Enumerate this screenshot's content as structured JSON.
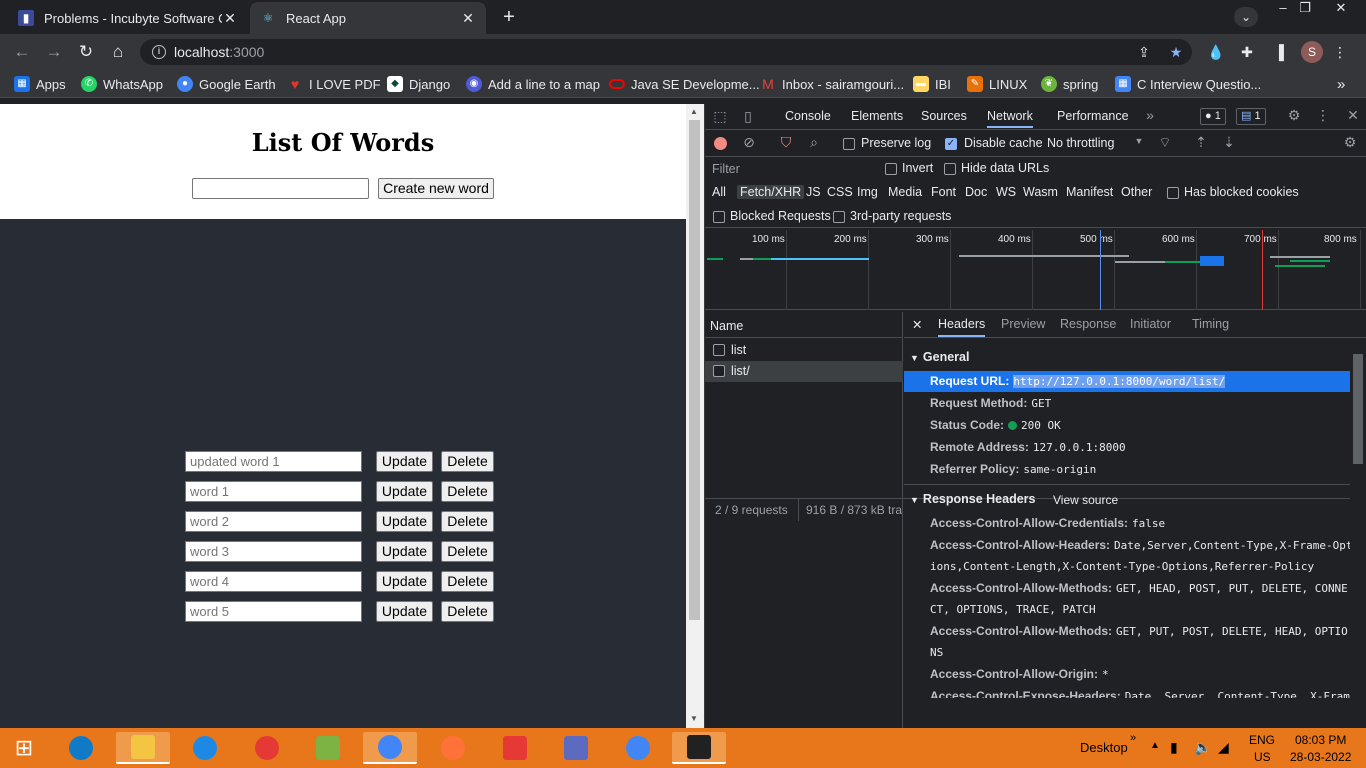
{
  "browser": {
    "tabs": [
      {
        "title": "Problems - Incubyte Software Cra",
        "favicon": "incubyte-icon"
      },
      {
        "title": "React App",
        "favicon": "react-icon"
      }
    ],
    "url_host": "localhost",
    "url_port": ":3000",
    "bookmarks": [
      {
        "label": "Apps",
        "icon": "apps-grid-icon",
        "color": "#1a73e8"
      },
      {
        "label": "WhatsApp",
        "icon": "whatsapp-icon",
        "color": "#25d366"
      },
      {
        "label": "Google Earth",
        "icon": "earth-icon",
        "color": "#4285f4"
      },
      {
        "label": "I LOVE PDF",
        "icon": "heart-icon",
        "color": "#e5322d"
      },
      {
        "label": "Django",
        "icon": "django-icon",
        "color": "#0c4b33"
      },
      {
        "label": "Add a line to a map",
        "icon": "map-line-icon",
        "color": "#4f5bd5"
      },
      {
        "label": "Java SE Developme...",
        "icon": "oracle-icon",
        "color": "#f80000"
      },
      {
        "label": "Inbox - sairamgouri...",
        "icon": "gmail-icon",
        "color": "#ea4335"
      },
      {
        "label": "IBI",
        "icon": "folder-icon",
        "color": "#fdd663"
      },
      {
        "label": "LINUX",
        "icon": "linux-icon",
        "color": "#e8710a"
      },
      {
        "label": "spring",
        "icon": "spring-icon",
        "color": "#6db33f"
      },
      {
        "label": "C Interview Questio...",
        "icon": "grid-icon",
        "color": "#4285f4"
      }
    ],
    "avatar_letter": "S"
  },
  "app": {
    "title": "List Of Words",
    "create_button": "Create new word",
    "update_label": "Update",
    "delete_label": "Delete",
    "words": [
      "updated word 1",
      "word 1",
      "word 2",
      "word 3",
      "word 4",
      "word 5"
    ]
  },
  "devtools": {
    "tabs": [
      "Console",
      "Elements",
      "Sources",
      "Network",
      "Performance"
    ],
    "active_tab": "Network",
    "error_count": "1",
    "message_count": "1",
    "preserve_log": "Preserve log",
    "disable_cache": "Disable cache",
    "throttling": "No throttling",
    "filter_placeholder": "Filter",
    "invert": "Invert",
    "hide_data_urls": "Hide data URLs",
    "types": [
      "All",
      "Fetch/XHR",
      "JS",
      "CSS",
      "Img",
      "Media",
      "Font",
      "Doc",
      "WS",
      "Wasm",
      "Manifest",
      "Other"
    ],
    "has_blocked_cookies": "Has blocked cookies",
    "blocked_requests": "Blocked Requests",
    "third_party": "3rd-party requests",
    "timeline_labels": [
      "100 ms",
      "200 ms",
      "300 ms",
      "400 ms",
      "500 ms",
      "600 ms",
      "700 ms",
      "800 ms"
    ],
    "name_header": "Name",
    "requests": [
      "list",
      "list/"
    ],
    "status_requests": "2 / 9 requests",
    "status_transferred": "916 B / 873 kB tra",
    "detail_tabs": [
      "Headers",
      "Preview",
      "Response",
      "Initiator",
      "Timing"
    ],
    "general_title": "General",
    "general": [
      {
        "k": "Request URL:",
        "v": "http://127.0.0.1:8000/word/list/"
      },
      {
        "k": "Request Method:",
        "v": "GET"
      },
      {
        "k": "Status Code:",
        "v": "200 OK"
      },
      {
        "k": "Remote Address:",
        "v": "127.0.0.1:8000"
      },
      {
        "k": "Referrer Policy:",
        "v": "same-origin"
      }
    ],
    "response_title": "Response Headers",
    "view_source": "View source",
    "response": [
      {
        "k": "Access-Control-Allow-Credentials:",
        "v": "false",
        "v2": ""
      },
      {
        "k": "Access-Control-Allow-Headers:",
        "v": "Date,Server,Content-Type,X-Frame-Opt",
        "v2": "ions,Content-Length,X-Content-Type-Options,Referrer-Policy"
      },
      {
        "k": "Access-Control-Allow-Methods:",
        "v": "GET, HEAD, POST, PUT, DELETE, CONNE",
        "v2": "CT, OPTIONS, TRACE, PATCH"
      },
      {
        "k": "Access-Control-Allow-Methods:",
        "v": "GET, PUT, POST, DELETE, HEAD, OPTIO",
        "v2": "NS"
      },
      {
        "k": "Access-Control-Allow-Origin:",
        "v": "*",
        "v2": ""
      },
      {
        "k": "Access-Control-Expose-Headers:",
        "v": "Date, Server, Content-Type, X-Fram",
        "v2": ""
      }
    ]
  },
  "taskbar": {
    "desktop_label": "Desktop",
    "lang": "ENG",
    "region": "US",
    "time": "08:03 PM",
    "date": "28-03-2022",
    "apps": [
      {
        "icon": "edge-icon",
        "color": "#0f7ac6"
      },
      {
        "icon": "file-explorer-icon",
        "color": "#f4c542"
      },
      {
        "icon": "sync-icon",
        "color": "#1e88e5"
      },
      {
        "icon": "headphones-icon",
        "color": "#e53935"
      },
      {
        "icon": "notepad-plus-icon",
        "color": "#7cb342"
      },
      {
        "icon": "chrome-icon",
        "color": "#4285f4"
      },
      {
        "icon": "firefox-icon",
        "color": "#ff7139"
      },
      {
        "icon": "sublime-icon",
        "color": "#e53935"
      },
      {
        "icon": "network-icon",
        "color": "#5c6bc0"
      },
      {
        "icon": "chrome-icon",
        "color": "#4285f4"
      },
      {
        "icon": "terminal-icon",
        "color": "#212121"
      }
    ]
  }
}
